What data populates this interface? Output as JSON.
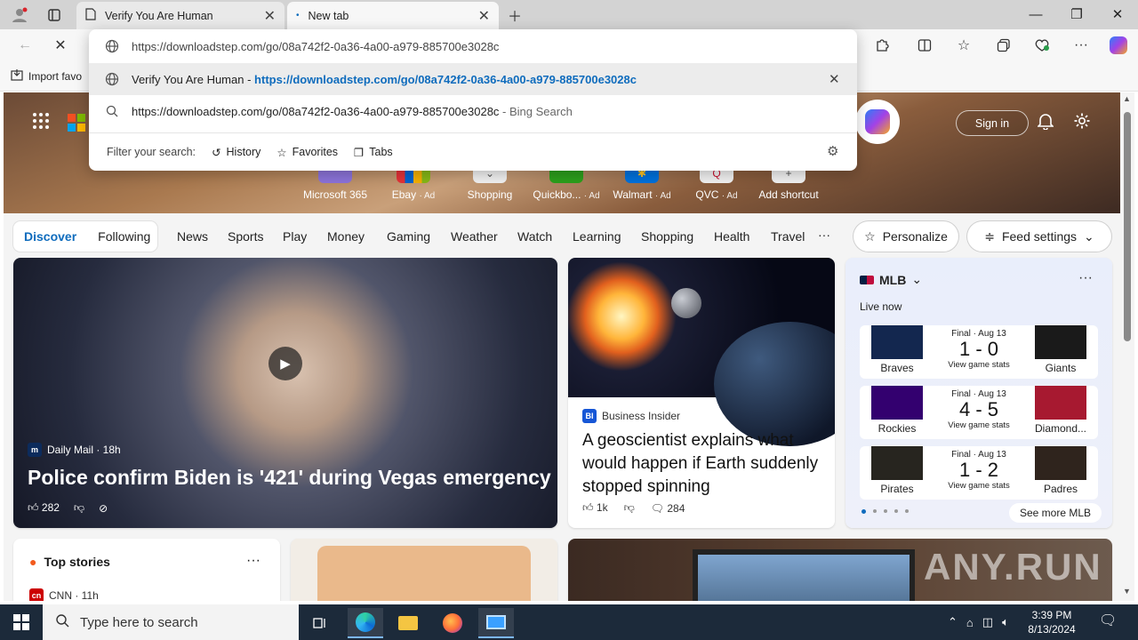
{
  "browser": {
    "tabs": [
      {
        "title": "Verify You Are Human"
      },
      {
        "title": "New tab"
      }
    ],
    "favorites_bar": {
      "import_label": "Import favo"
    },
    "omnibox": {
      "input_value": "https://downloadstep.com/go/08a742f2-0a36-4a00-a979-885700e3028c",
      "suggestions": [
        {
          "title": "Verify You Are Human",
          "separator": " - ",
          "url": "https://downloadstep.com/go/08a742f2-0a36-4a00-a979-885700e3028c"
        },
        {
          "query": "https://downloadstep.com/go/08a742f2-0a36-4a00-a979-885700e3028c",
          "suffix": " - Bing Search"
        }
      ],
      "filter_label": "Filter your search:",
      "filters": [
        "History",
        "Favorites",
        "Tabs"
      ]
    }
  },
  "newtab": {
    "shortcuts": [
      {
        "label": "Microsoft 365",
        "ad": ""
      },
      {
        "label": "Ebay",
        "ad": "· Ad"
      },
      {
        "label": "Shopping",
        "ad": ""
      },
      {
        "label": "Quickbo...",
        "ad": "· Ad"
      },
      {
        "label": "Walmart",
        "ad": "· Ad"
      },
      {
        "label": "QVC",
        "ad": "· Ad"
      },
      {
        "label": "Add shortcut",
        "ad": ""
      }
    ],
    "sign_in": "Sign in",
    "nav": {
      "pills": [
        "Discover",
        "Following"
      ],
      "links": [
        "News",
        "Sports",
        "Play",
        "Money",
        "Gaming",
        "Weather",
        "Watch",
        "Learning",
        "Shopping",
        "Health",
        "Travel"
      ],
      "more": "···",
      "personalize": "Personalize",
      "feed_settings": "Feed settings"
    },
    "main_story": {
      "source": "Daily Mail · 18h",
      "title": "Police confirm Biden is '421' during Vegas emergency",
      "likes": "282"
    },
    "geo_story": {
      "source": "Business Insider",
      "title": "A geoscientist explains what would happen if Earth suddenly stopped spinning",
      "likes": "1k",
      "comments": "284"
    },
    "mlb": {
      "league": "MLB",
      "live": "Live now",
      "games": [
        {
          "status": "Final · Aug 13",
          "score": "1 - 0",
          "stats": "View game stats",
          "home": "Braves",
          "away": "Giants",
          "home_color": "#13274f",
          "away_color": "#1a1a1a"
        },
        {
          "status": "Final · Aug 13",
          "score": "4 - 5",
          "stats": "View game stats",
          "home": "Rockies",
          "away": "Diamond...",
          "home_color": "#33006f",
          "away_color": "#a71930"
        },
        {
          "status": "Final · Aug 13",
          "score": "1 - 2",
          "stats": "View game stats",
          "home": "Pirates",
          "away": "Padres",
          "home_color": "#27251f",
          "away_color": "#2f241d"
        }
      ],
      "see_more": "See more MLB"
    },
    "top_stories": {
      "title": "Top stories",
      "source": "CNN · 11h"
    },
    "watermark": "ANY.RUN"
  },
  "taskbar": {
    "search_placeholder": "Type here to search",
    "time": "3:39 PM",
    "date": "8/13/2024"
  }
}
